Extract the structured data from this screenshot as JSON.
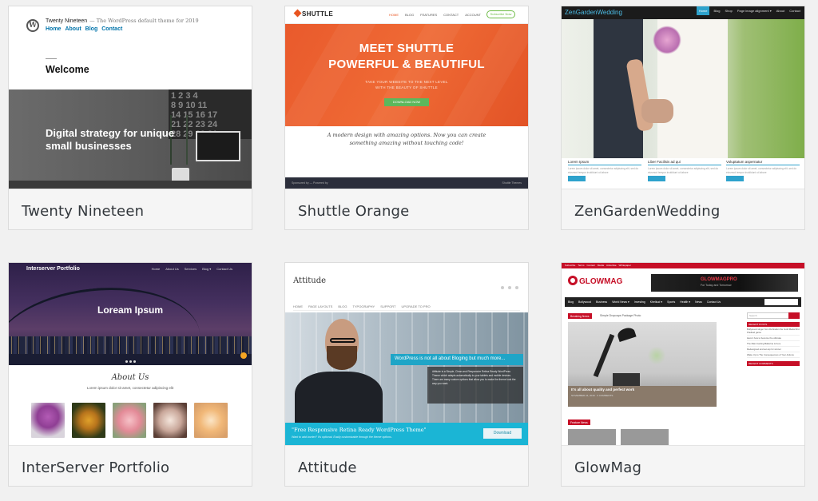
{
  "themes": [
    {
      "name": "Twenty Nineteen",
      "preview": {
        "site_title": "Twenty Nineteen",
        "tagline": "— The WordPress default theme for 2019",
        "menu": [
          "Home",
          "About",
          "Blog",
          "Contact"
        ],
        "welcome": "Welcome",
        "calendar": "1 2 3 4\n8 9 10 11\n14 15 16 17\n21 22 23 24\n28 29 30 31",
        "heading": "Digital strategy for unique small businesses"
      }
    },
    {
      "name": "Shuttle Orange",
      "preview": {
        "logo": "SHUTTLE",
        "nav": [
          "HOME",
          "BLOG",
          "FEATURES",
          "CONTACT",
          "ACCOUNT"
        ],
        "subscribe": "Subscribe Now",
        "hero_line1": "MEET SHUTTLE",
        "hero_line2": "POWERFUL & BEAUTIFUL",
        "hero_sub1": "TAKE YOUR WEBSITE TO THE NEXT LEVEL",
        "hero_sub2": "WITH THE BEAUTY OF SHUTTLE",
        "hero_button": "DOWNLOAD NOW",
        "tagline_1": "A modern design with amazing options. Now you can create",
        "tagline_2": "something amazing without touching code!",
        "footer_left": "Sponsored by — Powered by",
        "footer_right": "Shuttle Themes"
      }
    },
    {
      "name": "ZenGardenWedding",
      "preview": {
        "logo": "ZenGardenWedding",
        "nav": [
          "Home",
          "Blog",
          "Shop",
          "Page image alignment ▾",
          "About",
          "Contact"
        ],
        "columns": [
          {
            "title": "Lorem Ipsum",
            "text": "Lorem ipsum dolor sit amet, consectetur adipiscing elit, sed do eiusmod tempor incididunt ut labore"
          },
          {
            "title": "Liber Facilisis ad qui",
            "text": "Lorem ipsum dolor sit amet, consectetur adipiscing elit, sed do eiusmod tempor incididunt ut labore"
          },
          {
            "title": "Voluptatum aspernatur",
            "text": "Lorem ipsum dolor sit amet, consectetur adipiscing elit, sed do eiusmod tempor incididunt ut labore"
          }
        ],
        "more_button": "Read More"
      }
    },
    {
      "name": "InterServer Portfolio",
      "preview": {
        "logo": "Interserver Portfolio",
        "nav": [
          "Home",
          "About Us",
          "Services",
          "Blog ▾",
          "Contact Us"
        ],
        "hero_title": "Loream Ipsum",
        "about_title": "About Us",
        "about_sub": "Lorem ipsum dolor sit amet, consectetur adipiscing elit"
      }
    },
    {
      "name": "Attitude",
      "preview": {
        "logo": "Attitude",
        "nav": [
          "HOME",
          "PAGE LAYOUTS",
          "BLOG",
          "TYPOGRAPHY",
          "SUPPORT",
          "UPGRADE TO PRO"
        ],
        "caption_title": "WordPress is not all about Bloging but much more...",
        "caption_text": "Attitude is a Simple, Clean and Responsive Retina Ready WordPress Theme which adapts automatically to your tablets and mobile devices. There are many custom options that allow you to make the theme look the way you want.",
        "quote": "\"Free Responsive Retina Ready WordPress Theme\"",
        "quote_sub": "Want to add border? It's optional. Easily customizable through the theme options.",
        "download": "Download"
      }
    },
    {
      "name": "GlowMag",
      "preview": {
        "top_links": [
          "Subscribe",
          "Terms",
          "Contact",
          "Media",
          "Advertise",
          "Whitepaper"
        ],
        "logo": "GLOWMAG",
        "ad_title": "GLOWMAGPRO",
        "ad_sub": "For Today and Tomorrow",
        "nav": [
          "Blog",
          "Bollywood",
          "Business",
          "World News ▾",
          "Investing",
          "Khelkud ▾",
          "Sports",
          "Health ▾",
          "News",
          "Contact Us"
        ],
        "breaking_label": "Breaking News",
        "breaking_text": "Simple Dropcaps Package Photo",
        "main_caption": "It's all about quality and perfect work",
        "main_meta": "NOVEMBER 24, 2019 · 0 COMMENTS",
        "feature_label": "Feature News",
        "side_search": "Search",
        "recent_posts": "RECENT POSTS",
        "recent_items": [
          "Bollywood singer from Dehradun the Gold Medal first Khelkud game",
          "Here's how to become the ultimate",
          "The Main Getting Ballerina is here",
          "Redesigned and set-top for winner",
          "Wake Up to The Consequences of Your Actions"
        ],
        "recent_comments": "RECENT COMMENTS"
      }
    }
  ]
}
